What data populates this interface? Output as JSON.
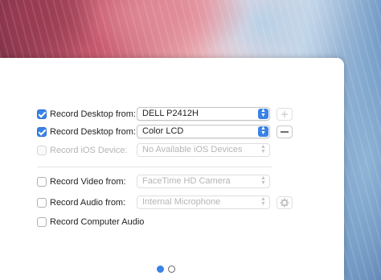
{
  "rows": [
    {
      "label": "Record Desktop from:",
      "checked": true,
      "enabled": true,
      "value": "DELL P2412H",
      "button_icon": "plus-icon",
      "button_enabled": false
    },
    {
      "label": "Record Desktop from:",
      "checked": true,
      "enabled": true,
      "value": "Color LCD",
      "button_icon": "minus-icon",
      "button_enabled": true
    },
    {
      "label": "Record iOS Device:",
      "checked": false,
      "enabled": false,
      "value": "No Available iOS Devices"
    },
    {
      "label": "Record Video from:",
      "checked": false,
      "enabled": true,
      "value": "FaceTime HD Camera"
    },
    {
      "label": "Record Audio from:",
      "checked": false,
      "enabled": true,
      "value": "Internal Microphone",
      "button_icon": "gear-icon",
      "button_enabled": false
    },
    {
      "label": "Record Computer Audio",
      "checked": false,
      "enabled": true
    }
  ],
  "pagination": {
    "pages": 2,
    "current": 1
  },
  "colors": {
    "accent": "#3b82e6",
    "disabled_text": "#b5b5b5"
  }
}
